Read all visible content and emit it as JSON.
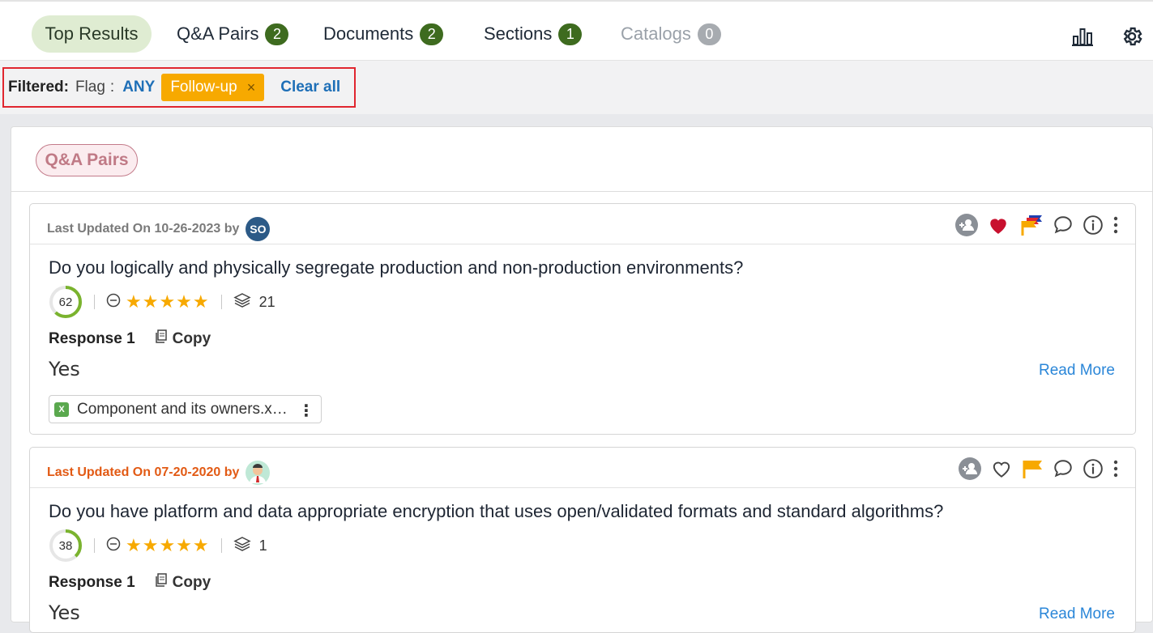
{
  "tabs": [
    {
      "label": "Top Results",
      "count": null
    },
    {
      "label": "Q&A Pairs",
      "count": "2"
    },
    {
      "label": "Documents",
      "count": "2"
    },
    {
      "label": "Sections",
      "count": "1"
    },
    {
      "label": "Catalogs",
      "count": "0"
    }
  ],
  "top_icons": [
    "bar-chart-icon",
    "gear-icon"
  ],
  "filter": {
    "label": "Filtered:",
    "field": "Flag",
    "colon": ":",
    "operator": "ANY",
    "chip_label": "Follow-up",
    "chip_remove": "×",
    "clear_label": "Clear all"
  },
  "section_label": "Q&A Pairs",
  "cards": [
    {
      "updated": "Last Updated On 10-26-2023 by",
      "avatar_initials": "SO",
      "question": "Do you logically and physically segregate production and non-production environments?",
      "score": "62",
      "score_fraction": 0.62,
      "stars": "★★★★★",
      "usage_count": "21",
      "response_label": "Response 1",
      "copy_label": "Copy",
      "answer": "Yes",
      "read_more": "Read More",
      "attachment": "Component and its owners.x…",
      "favorited": true,
      "flag_color": "#f7a900"
    },
    {
      "updated": "Last Updated On 07-20-2020 by",
      "avatar_initials": "",
      "question": "Do you have platform and data appropriate encryption that uses open/validated formats and standard algorithms?",
      "score": "38",
      "score_fraction": 0.38,
      "stars": "★★★★★",
      "usage_count": "1",
      "response_label": "Response 1",
      "copy_label": "Copy",
      "answer": "Yes",
      "read_more": "Read More",
      "favorited": false,
      "flag_color": "#f7a900"
    }
  ],
  "colors": {
    "accent_green": "#3e6b1f",
    "link_blue": "#1e6fb7",
    "chip_orange": "#f7a900",
    "heart_red": "#c8102e",
    "highlight_red": "#e0262f"
  }
}
